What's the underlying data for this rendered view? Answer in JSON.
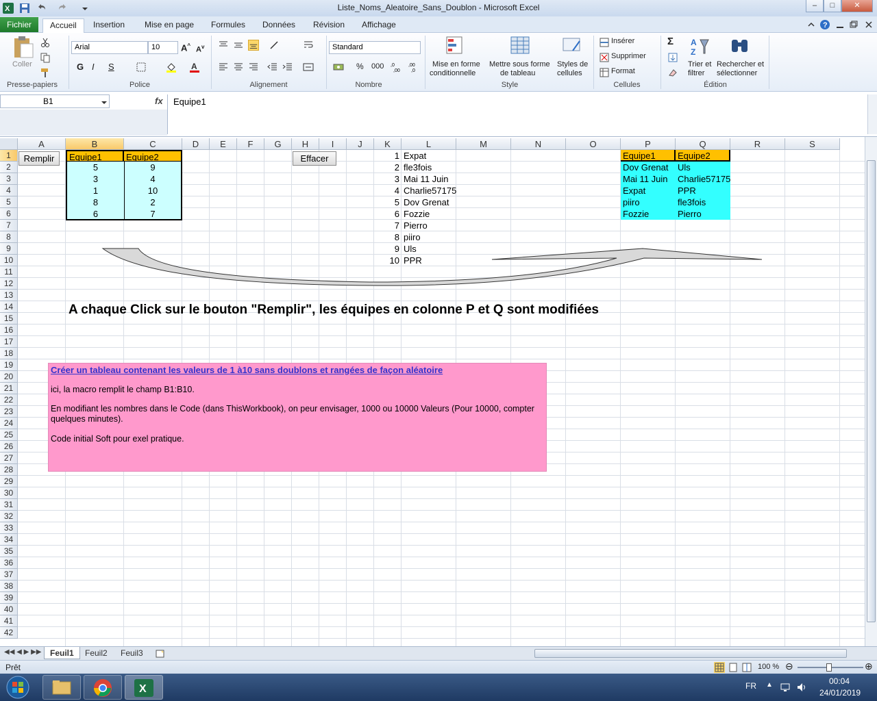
{
  "window": {
    "title": "Liste_Noms_Aleatoire_Sans_Doublon - Microsoft Excel"
  },
  "menu": {
    "file": "Fichier",
    "tabs": [
      "Accueil",
      "Insertion",
      "Mise en page",
      "Formules",
      "Données",
      "Révision",
      "Affichage"
    ]
  },
  "ribbon": {
    "clipboard": {
      "paste": "Coller",
      "label": "Presse-papiers"
    },
    "font": {
      "name": "Arial",
      "size": "10",
      "bold": "G",
      "italic": "I",
      "underline": "S",
      "label": "Police"
    },
    "alignment": {
      "label": "Alignement"
    },
    "number": {
      "format": "Standard",
      "percent": "%",
      "thousands": "000",
      "label": "Nombre"
    },
    "style": {
      "conditional_1": "Mise en forme",
      "conditional_2": "conditionnelle",
      "table_1": "Mettre sous forme",
      "table_2": "de tableau",
      "cellstyle_1": "Styles de",
      "cellstyle_2": "cellules",
      "label": "Style"
    },
    "cells": {
      "insert": "Insérer",
      "delete": "Supprimer",
      "format": "Format",
      "label": "Cellules"
    },
    "editing": {
      "sort_1": "Trier et",
      "sort_2": "filtrer",
      "find_1": "Rechercher et",
      "find_2": "sélectionner",
      "label": "Édition"
    }
  },
  "formula_bar": {
    "name_box": "B1",
    "fx": "fx",
    "content": "Equipe1"
  },
  "columns": [
    "A",
    "B",
    "C",
    "D",
    "E",
    "F",
    "G",
    "H",
    "I",
    "J",
    "K",
    "L",
    "M",
    "N",
    "O",
    "P",
    "Q",
    "R",
    "S"
  ],
  "rows": [
    "1",
    "2",
    "3",
    "4",
    "5",
    "6",
    "7",
    "8",
    "9",
    "10",
    "11",
    "12",
    "13",
    "14",
    "15",
    "16",
    "17",
    "18",
    "19",
    "20",
    "21",
    "22",
    "23",
    "24",
    "25",
    "26",
    "27",
    "28",
    "29",
    "30",
    "31",
    "32",
    "33",
    "34",
    "35",
    "36",
    "37",
    "38",
    "39",
    "40",
    "41",
    "42"
  ],
  "sheet": {
    "btn_remplir": "Remplir",
    "btn_effacer": "Effacer",
    "header_b": "Equipe1",
    "header_c": "Equipe2",
    "colB": [
      "5",
      "3",
      "1",
      "8",
      "6"
    ],
    "colC": [
      "9",
      "4",
      "10",
      "2",
      "7"
    ],
    "colK": [
      "1",
      "2",
      "3",
      "4",
      "5",
      "6",
      "7",
      "8",
      "9",
      "10"
    ],
    "colL": [
      "Expat",
      "fle3fois",
      "Mai 11 Juin",
      "Charlie57175",
      "Dov Grenat",
      "Fozzie",
      "Pierro",
      "piiro",
      "Uls",
      "PPR"
    ],
    "header_p": "Equipe1",
    "header_q": "Equipe2",
    "colP": [
      "Dov Grenat",
      "Mai 11 Juin",
      "Expat",
      "piiro",
      "Fozzie"
    ],
    "colQ": [
      "Uls",
      "Charlie57175",
      "PPR",
      "fle3fois",
      "Pierro"
    ],
    "big_text": "A chaque Click sur le bouton \"Remplir\", les équipes en colonne P et Q sont modifiées",
    "note": {
      "title": "Créer un tableau contenant les valeurs de 1 à10 sans doublons et rangées de façon aléatoire",
      "line1": "ici, la macro remplit le champ B1:B10.",
      "line2": "En modifiant les nombres dans le Code (dans ThisWorkbook), on peur envisager, 1000 ou 10000 Valeurs (Pour 10000, compter quelques minutes).",
      "line3": "Code initial Soft pour exel pratique."
    }
  },
  "sheet_tabs": [
    "Feuil1",
    "Feuil2",
    "Feuil3"
  ],
  "status": {
    "ready": "Prêt",
    "zoom": "100 %"
  },
  "taskbar": {
    "lang": "FR",
    "time": "00:04",
    "date": "24/01/2019"
  },
  "colors": {
    "header_fill": "#ffc000",
    "cyan_light": "#ccffff",
    "cyan": "#33ffff",
    "note_fill": "#ff99cc",
    "link_blue": "#3333cc"
  }
}
